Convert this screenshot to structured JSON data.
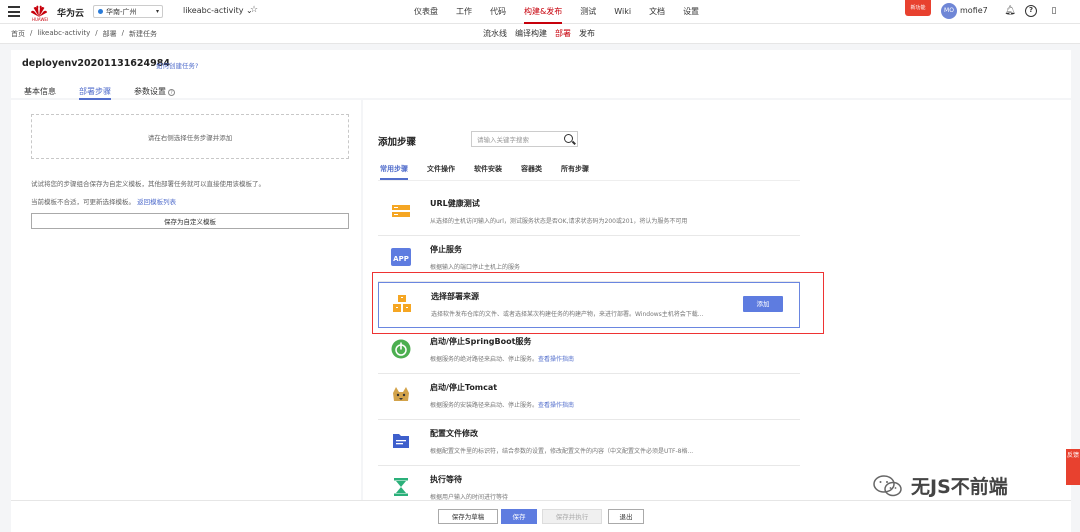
{
  "topbar": {
    "brand": "华为云",
    "logo_text": "HUAWEI",
    "region": "华南-广州",
    "project": "likeabc-activity ⌄",
    "nav": [
      "仪表盘",
      "工作",
      "代码",
      "构建&发布",
      "测试",
      "Wiki",
      "文档",
      "设置"
    ],
    "nav_active": "构建&发布",
    "promo_badge": "新功能",
    "avatar_initials": "MO",
    "username": "mofie7"
  },
  "subbar": {
    "breadcrumb": [
      "首页",
      "/",
      "likeabc-activity",
      "/",
      "部署",
      "/",
      "新建任务"
    ],
    "subnav": [
      "流水线",
      "编译构建",
      "部署",
      "发布"
    ],
    "subnav_active": "部署"
  },
  "header": {
    "task_name": "deployenv20201131624984",
    "help_link": "如何创建任务?",
    "tabs": [
      "基本信息",
      "部署步骤",
      "参数设置"
    ],
    "active_tab": "部署步骤"
  },
  "left": {
    "dropzone_text": "请在右侧选择任务步骤并添加",
    "tip1": "试试将您的步骤组合保存为自定义模板，其他部署任务就可以直接使用该模板了。",
    "tip2_prefix": "当前模板不合适，可更新选择模板。",
    "tip2_link": "返回模板列表",
    "save_template_button": "保存为自定义模板"
  },
  "right": {
    "title": "添加步骤",
    "search_placeholder": "请输入关键字搜索",
    "categories": [
      "常用步骤",
      "文件操作",
      "软件安装",
      "容器类",
      "所有步骤"
    ],
    "active_category": "常用步骤",
    "steps": [
      {
        "name": "URL健康测试",
        "desc": "从选择的主机访问输入的url，测试服务状态是否OK,请求状态码为200或201，将认为服务不可用",
        "link": "",
        "icon": "url-test-icon"
      },
      {
        "name": "停止服务",
        "desc": "根据输入的端口停止主机上的服务",
        "link": "",
        "icon": "app-icon"
      },
      {
        "name": "选择部署来源",
        "desc": "选择软件发布仓库的文件、或者选择某次构建任务的构建产物，来进行部署。Windows主机将会下载...",
        "link": "",
        "icon": "package-icon",
        "selected": true,
        "add_label": "添加"
      },
      {
        "name": "启动/停止SpringBoot服务",
        "desc": "根据服务的绝对路径来启动、停止服务。",
        "link": "查看操作指南",
        "icon": "springboot-icon"
      },
      {
        "name": "启动/停止Tomcat",
        "desc": "根据服务的安装路径来启动、停止服务。",
        "link": "查看操作指南",
        "icon": "tomcat-icon"
      },
      {
        "name": "配置文件修改",
        "desc": "根据配置文件里的标识符，结合参数的设置，修改配置文件的内容（中文配置文件必须是UTF-8格...",
        "link": "",
        "icon": "config-file-icon"
      },
      {
        "name": "执行等待",
        "desc": "根据用户输入的时间进行等待",
        "link": "",
        "icon": "hourglass-icon"
      }
    ]
  },
  "bottombar": {
    "buttons": [
      "保存为草稿",
      "保存",
      "保存并执行",
      "退出"
    ]
  },
  "side_tab": "反馈",
  "watermark": "无JS不前端",
  "colors": {
    "brand_red": "#c7000b",
    "primary_blue": "#5e7ce0",
    "highlight_red": "#e33333"
  }
}
